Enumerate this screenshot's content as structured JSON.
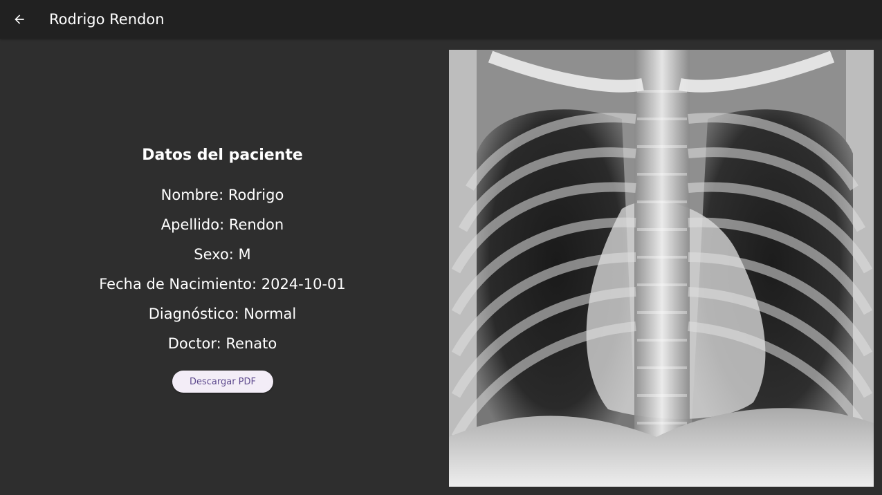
{
  "app_bar": {
    "title": "Rodrigo Rendon",
    "back_icon": "arrow-back-icon"
  },
  "patient": {
    "heading": "Datos del paciente",
    "nombre": "Nombre: Rodrigo",
    "apellido": "Apellido: Rendon",
    "sexo": "Sexo: M",
    "fecha": "Fecha de Nacimiento: 2024-10-01",
    "diagnostico": "Diagnóstico: Normal",
    "doctor": "Doctor: Renato"
  },
  "actions": {
    "download_pdf": "Descargar PDF"
  },
  "colors": {
    "app_bar": "#212121",
    "background": "#2e2e2e",
    "button_bg": "#f3edf7",
    "button_text": "#5e4a8e"
  }
}
